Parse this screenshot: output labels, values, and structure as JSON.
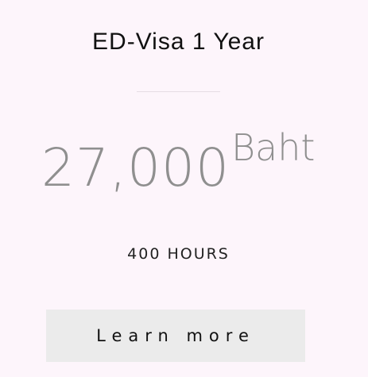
{
  "plan": {
    "title": "ED-Visa 1 Year",
    "price_amount": "27,000",
    "price_currency": "Baht",
    "hours": "400 HOURS",
    "cta_label": "Learn more"
  }
}
